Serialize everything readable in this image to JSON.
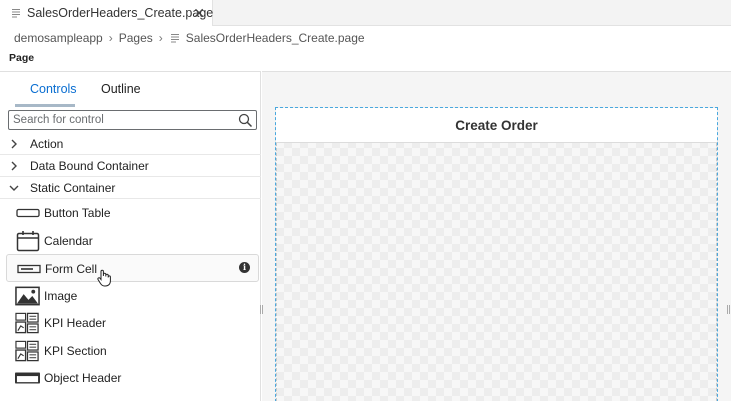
{
  "editor": {
    "tab_title": "SalesOrderHeaders_Create.page",
    "tab_close": "✕"
  },
  "breadcrumb": {
    "items": [
      "demosampleapp",
      "Pages",
      "SalesOrderHeaders_Create.page"
    ]
  },
  "section_label": "Page",
  "panel": {
    "tabs": [
      "Controls",
      "Outline"
    ],
    "active_tab": "Controls",
    "search_placeholder": "Search for control",
    "categories": [
      {
        "label": "Action",
        "expanded": false
      },
      {
        "label": "Data Bound Container",
        "expanded": false
      },
      {
        "label": "Static Container",
        "expanded": true
      }
    ],
    "controls": [
      {
        "label": "Button Table",
        "icon": "button-table-icon"
      },
      {
        "label": "Calendar",
        "icon": "calendar-icon"
      },
      {
        "label": "Form Cell",
        "icon": "form-cell-icon",
        "hovered": true,
        "info": "i"
      },
      {
        "label": "Image",
        "icon": "image-icon"
      },
      {
        "label": "KPI Header",
        "icon": "kpi-header-icon"
      },
      {
        "label": "KPI Section",
        "icon": "kpi-section-icon"
      },
      {
        "label": "Object Header",
        "icon": "object-header-icon"
      }
    ]
  },
  "canvas": {
    "page_title": "Create Order"
  },
  "colors": {
    "accent": "#0a6ed1",
    "selection_border": "#4aa8de"
  }
}
